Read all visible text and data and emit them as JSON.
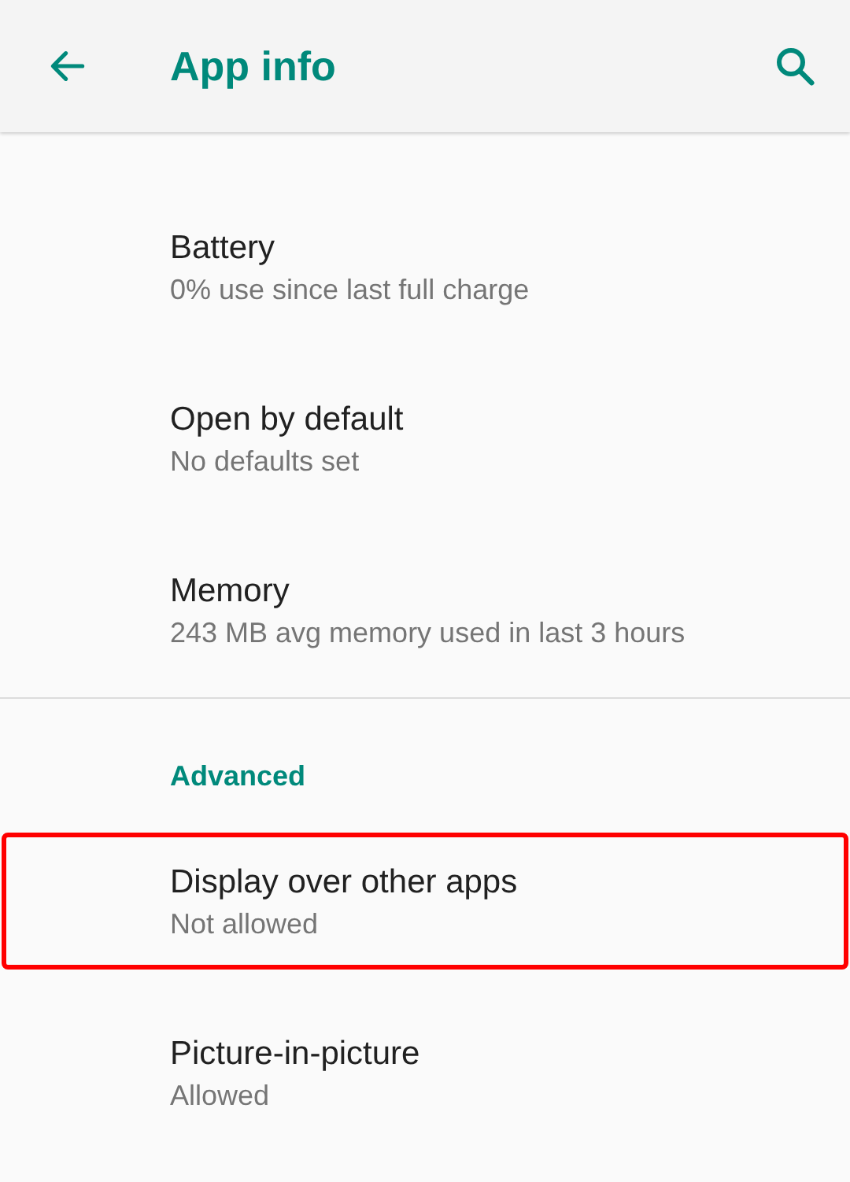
{
  "app_bar": {
    "title": "App info"
  },
  "items": [
    {
      "kind": "row",
      "title": "Battery",
      "summary": "0% use since last full charge",
      "highlighted": false
    },
    {
      "kind": "row",
      "title": "Open by default",
      "summary": "No defaults set",
      "highlighted": false
    },
    {
      "kind": "row",
      "title": "Memory",
      "summary": "243 MB avg memory used in last 3 hours",
      "highlighted": false
    },
    {
      "kind": "divider"
    },
    {
      "kind": "header",
      "title": "Advanced"
    },
    {
      "kind": "row",
      "title": "Display over other apps",
      "summary": "Not allowed",
      "highlighted": true
    },
    {
      "kind": "row",
      "title": "Picture-in-picture",
      "summary": "Allowed",
      "highlighted": false
    }
  ]
}
